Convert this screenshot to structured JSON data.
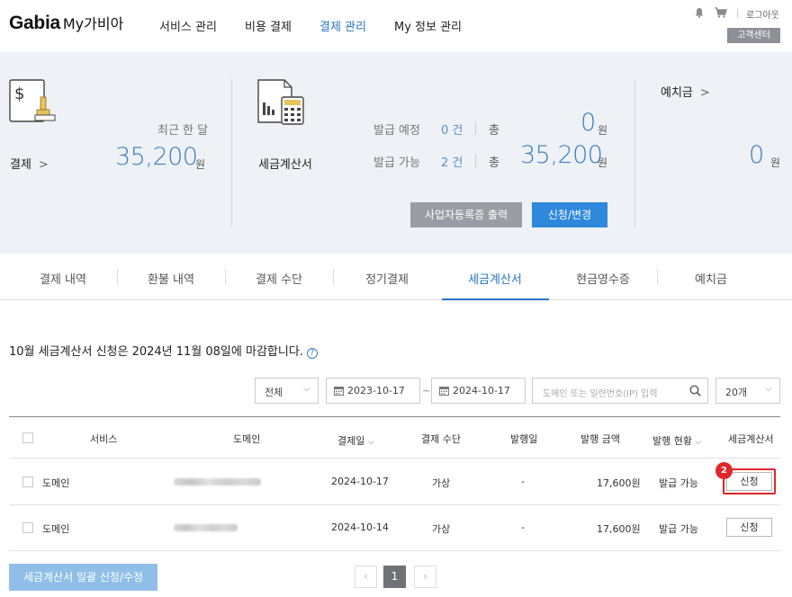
{
  "header": {
    "logo_brand": "Gabia",
    "logo_sub": "My가비아",
    "nav": [
      {
        "label": "서비스 관리",
        "active": false
      },
      {
        "label": "비용 결제",
        "active": false
      },
      {
        "label": "결제 관리",
        "active": true
      },
      {
        "label": "My 정보 관리",
        "active": false
      }
    ],
    "logout": "로그아웃",
    "customer_center": "고객센터"
  },
  "summary": {
    "payment": {
      "label": "결제",
      "period": "최근 한 달",
      "amount": "35,200",
      "unit": "원"
    },
    "tax_invoice": {
      "label": "세금계산서",
      "scheduled_label": "발급 예정",
      "scheduled_count": "0 건",
      "available_label": "발급 가능",
      "available_count": "2 건",
      "total_label": "총",
      "scheduled_total": "0",
      "available_total": "35,200",
      "unit": "원",
      "print_button": "사업자등록증 출력",
      "apply_button": "신청/변경"
    },
    "deposit": {
      "label": "예치금",
      "amount": "0",
      "unit": "원"
    }
  },
  "tabs": [
    {
      "label": "결제 내역",
      "active": false
    },
    {
      "label": "환불 내역",
      "active": false
    },
    {
      "label": "결제 수단",
      "active": false
    },
    {
      "label": "정기결제",
      "active": false
    },
    {
      "label": "세금계산서",
      "active": true
    },
    {
      "label": "현금영수증",
      "active": false
    },
    {
      "label": "예치금",
      "active": false
    }
  ],
  "notice": "10월 세금계산서 신청은 2024년 11월 08일에 마감합니다.",
  "filters": {
    "scope": "전체",
    "date_from": "2023-10-17",
    "date_to": "2024-10-17",
    "tilde": "~",
    "search_placeholder": "도메인 또는 일련번호(IP) 입력",
    "page_size": "20개"
  },
  "table": {
    "headers": {
      "service": "서비스",
      "domain": "도메인",
      "pay_date": "결제일",
      "pay_method": "결제 수단",
      "issue_date": "발행일",
      "issue_amount": "발행 금액",
      "issue_status": "발행 현황",
      "invoice": "세금계산서"
    },
    "rows": [
      {
        "service": "도메인",
        "pay_date": "2024-10-17",
        "pay_method": "가상",
        "issue_date": "-",
        "amount": "17,600원",
        "status": "발급 가능",
        "action": "신청"
      },
      {
        "service": "도메인",
        "pay_date": "2024-10-14",
        "pay_method": "가상",
        "issue_date": "-",
        "amount": "17,600원",
        "status": "발급 가능",
        "action": "신청"
      }
    ]
  },
  "annotation_badge": "2",
  "bulk_button": "세금계산서 일괄 신청/수정",
  "pagination": {
    "prev": "‹",
    "current": "1",
    "next": "›"
  },
  "colors": {
    "accent": "#2a75c4",
    "panel_bg": "#eef1f6",
    "highlight": "#e0262b"
  }
}
